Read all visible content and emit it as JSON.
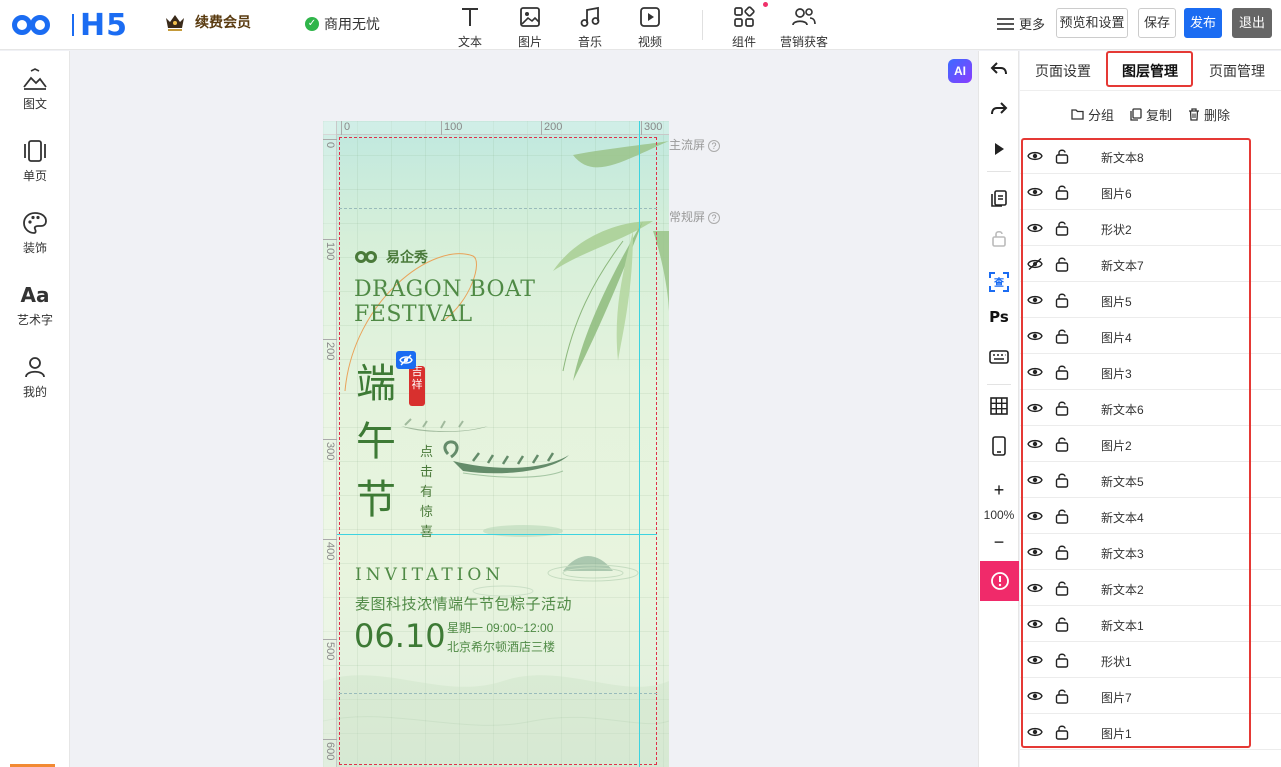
{
  "app": {
    "logo_text": "H5",
    "member_label": "续费会员",
    "commercial_label": "商用无忧"
  },
  "toolbar": {
    "tools": [
      {
        "label": "文本",
        "icon": "text-icon"
      },
      {
        "label": "图片",
        "icon": "image-icon"
      },
      {
        "label": "音乐",
        "icon": "music-icon"
      },
      {
        "label": "视频",
        "icon": "video-icon"
      },
      {
        "label": "组件",
        "icon": "components-icon"
      },
      {
        "label": "营销获客",
        "icon": "marketing-icon"
      }
    ],
    "more_label": "更多",
    "preview_label": "预览和设置",
    "save_label": "保存",
    "publish_label": "发布",
    "exit_label": "退出"
  },
  "sidebar": {
    "items": [
      {
        "label": "图文",
        "icon": "image-text-icon"
      },
      {
        "label": "单页",
        "icon": "single-page-icon"
      },
      {
        "label": "装饰",
        "icon": "palette-icon"
      },
      {
        "label": "艺术字",
        "icon": "art-text-icon"
      },
      {
        "label": "我的",
        "icon": "user-icon"
      }
    ]
  },
  "canvas": {
    "ai_label": "AI",
    "ruler_top": [
      "0",
      "100",
      "200",
      "300"
    ],
    "ruler_left": [
      "0",
      "100",
      "200",
      "300",
      "400",
      "500",
      "600"
    ],
    "main_screen_label": "主流屏",
    "normal_screen_label": "常规屏",
    "help_glyph": "?",
    "content": {
      "brand": "易企秀",
      "title_en_1": "DRAGON BOAT",
      "title_en_2": "FESTIVAL",
      "title_cn": "端午节",
      "seal_text": "吉祥",
      "vertical_text": "点击有惊喜",
      "invitation": "INVITATION",
      "activity": "麦图科技浓情端午节包粽子活动",
      "date": "06.10",
      "time": "星期一  09:00~12:00",
      "location": "北京希尔顿酒店三楼"
    }
  },
  "toolcolumn": {
    "zoom_level": "100%",
    "ps_label": "Ps"
  },
  "panel": {
    "tabs": [
      "页面设置",
      "图层管理",
      "页面管理"
    ],
    "active_tab": "图层管理",
    "actions": {
      "group": "分组",
      "copy": "复制",
      "delete": "删除"
    },
    "layers": [
      {
        "name": "新文本8",
        "visible": true
      },
      {
        "name": "图片6",
        "visible": true
      },
      {
        "name": "形状2",
        "visible": true
      },
      {
        "name": "新文本7",
        "visible": false
      },
      {
        "name": "图片5",
        "visible": true
      },
      {
        "name": "图片4",
        "visible": true
      },
      {
        "name": "图片3",
        "visible": true
      },
      {
        "name": "新文本6",
        "visible": true
      },
      {
        "name": "图片2",
        "visible": true
      },
      {
        "name": "新文本5",
        "visible": true
      },
      {
        "name": "新文本4",
        "visible": true
      },
      {
        "name": "新文本3",
        "visible": true
      },
      {
        "name": "新文本2",
        "visible": true
      },
      {
        "name": "新文本1",
        "visible": true
      },
      {
        "name": "形状1",
        "visible": true
      },
      {
        "name": "图片7",
        "visible": true
      },
      {
        "name": "图片1",
        "visible": true
      }
    ]
  },
  "colors": {
    "brand_blue": "#1b6cf2",
    "alert_pink": "#f02a6a",
    "highlight_red": "#e53935",
    "festival_green": "#4f8a45"
  }
}
